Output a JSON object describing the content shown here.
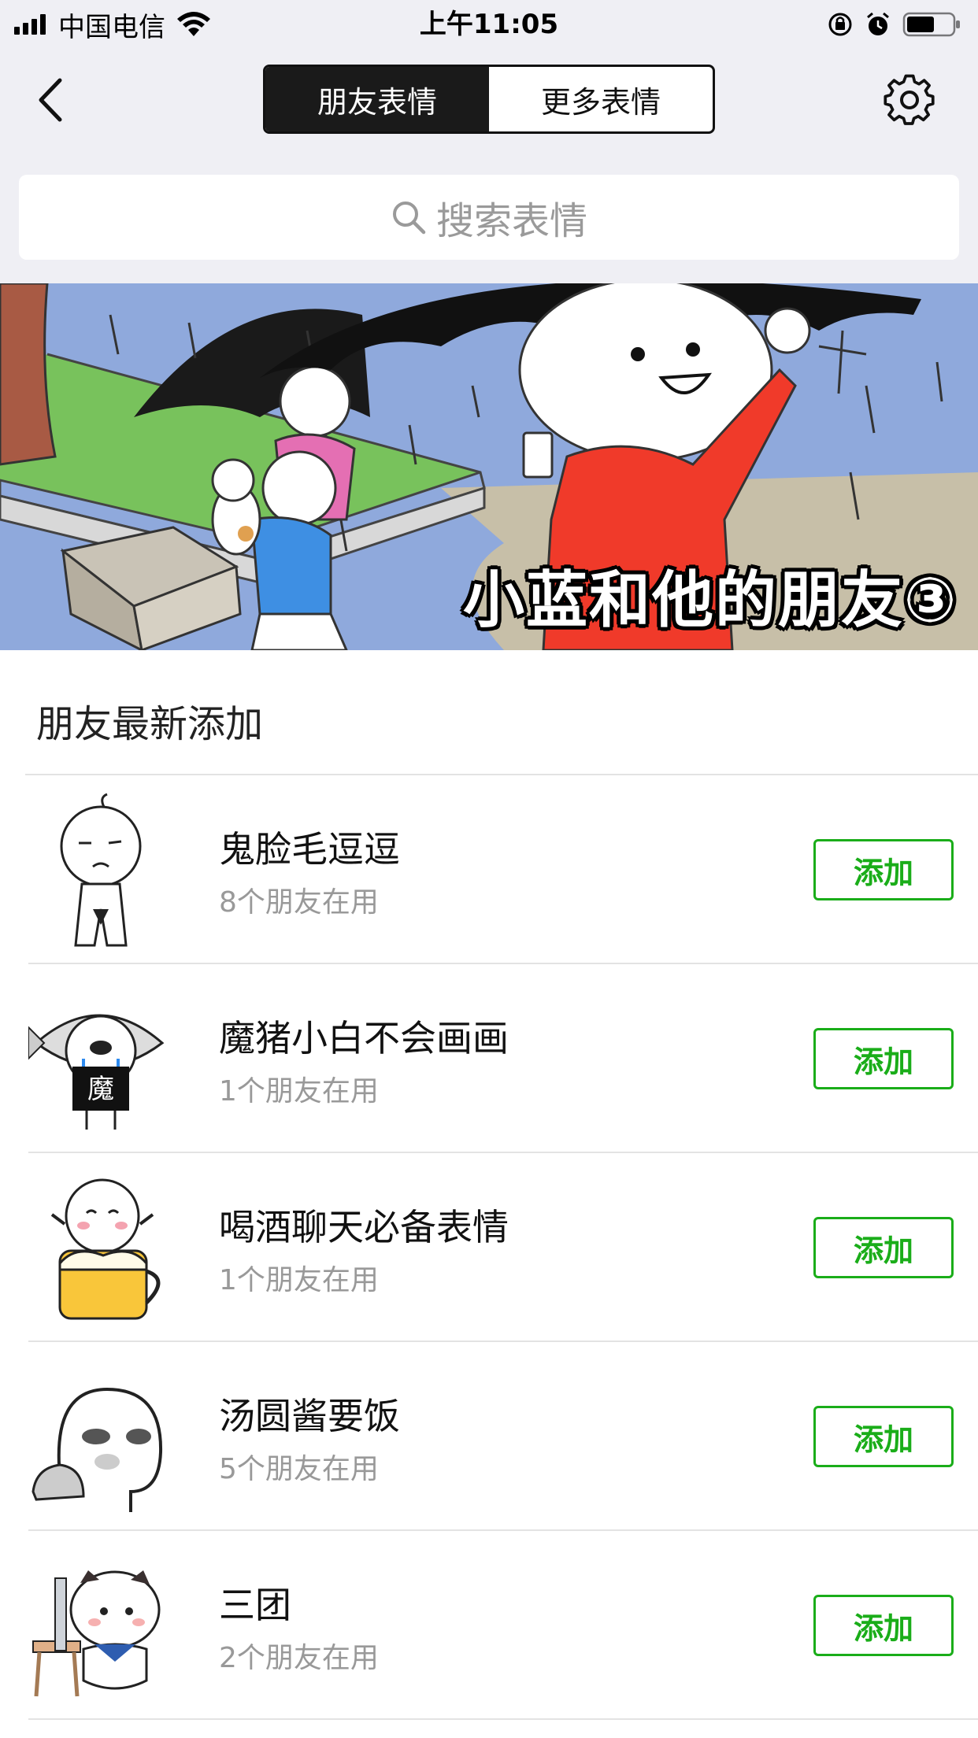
{
  "status_bar": {
    "carrier": "中国电信",
    "time": "上午11:05"
  },
  "nav": {
    "back_icon": "chevron-left-icon",
    "tabs": [
      {
        "label": "朋友表情",
        "active": true
      },
      {
        "label": "更多表情",
        "active": false
      }
    ],
    "settings_icon": "gear-icon"
  },
  "search": {
    "placeholder": "搜索表情",
    "icon": "search-icon"
  },
  "banner": {
    "caption": "小蓝和他的朋友③"
  },
  "section": {
    "title": "朋友最新添加"
  },
  "items": [
    {
      "name": "鬼脸毛逗逗",
      "usage": "8个朋友在用",
      "action": "添加"
    },
    {
      "name": "魔猪小白不会画画",
      "usage": "1个朋友在用",
      "action": "添加"
    },
    {
      "name": "喝酒聊天必备表情",
      "usage": "1个朋友在用",
      "action": "添加"
    },
    {
      "name": "汤圆酱要饭",
      "usage": "5个朋友在用",
      "action": "添加"
    },
    {
      "name": "三团",
      "usage": "2个朋友在用",
      "action": "添加"
    }
  ],
  "colors": {
    "accent_green": "#1aad19",
    "nav_background": "#efeff4",
    "segment_active": "#1a1a1a"
  }
}
